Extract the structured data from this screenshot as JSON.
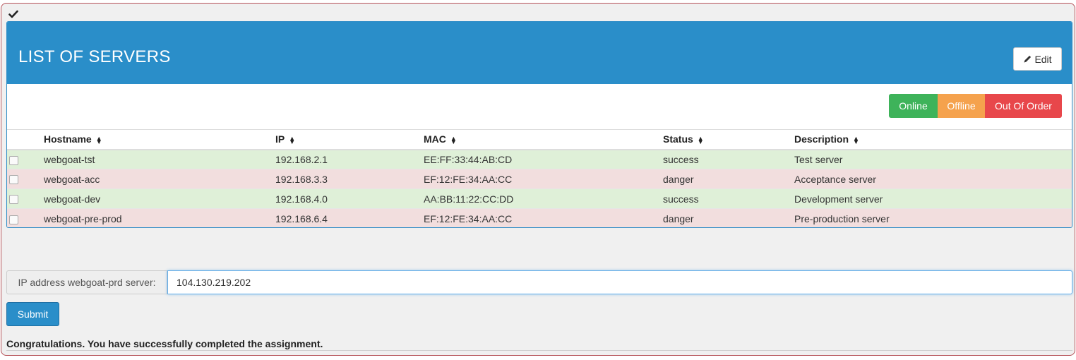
{
  "assignment": {
    "completed_icon": "checkmark-icon"
  },
  "panel": {
    "title": "LIST OF SERVERS",
    "edit_label": "Edit",
    "edit_icon": "pencil-icon",
    "heading_color": "#2a8ec9"
  },
  "status_buttons": {
    "online": "Online",
    "offline": "Offline",
    "out_of_order": "Out Of Order",
    "colors": {
      "online": "#3eb35a",
      "offline": "#f5a24d",
      "out_of_order": "#e8474b"
    }
  },
  "table": {
    "columns": [
      "Hostname",
      "IP",
      "MAC",
      "Status",
      "Description"
    ],
    "sort_icon": "sort-icon",
    "rows": [
      {
        "hostname": "webgoat-tst",
        "ip": "192.168.2.1",
        "mac": "EE:FF:33:44:AB:CD",
        "status": "success",
        "description": "Test server"
      },
      {
        "hostname": "webgoat-acc",
        "ip": "192.168.3.3",
        "mac": "EF:12:FE:34:AA:CC",
        "status": "danger",
        "description": "Acceptance server"
      },
      {
        "hostname": "webgoat-dev",
        "ip": "192.168.4.0",
        "mac": "AA:BB:11:22:CC:DD",
        "status": "success",
        "description": "Development server"
      },
      {
        "hostname": "webgoat-pre-prod",
        "ip": "192.168.6.4",
        "mac": "EF:12:FE:34:AA:CC",
        "status": "danger",
        "description": "Pre-production server"
      }
    ]
  },
  "form": {
    "ip_label": "IP address webgoat-prd server:",
    "ip_value": "104.130.219.202",
    "submit_label": "Submit"
  },
  "feedback": {
    "message": "Congratulations. You have successfully completed the assignment."
  }
}
